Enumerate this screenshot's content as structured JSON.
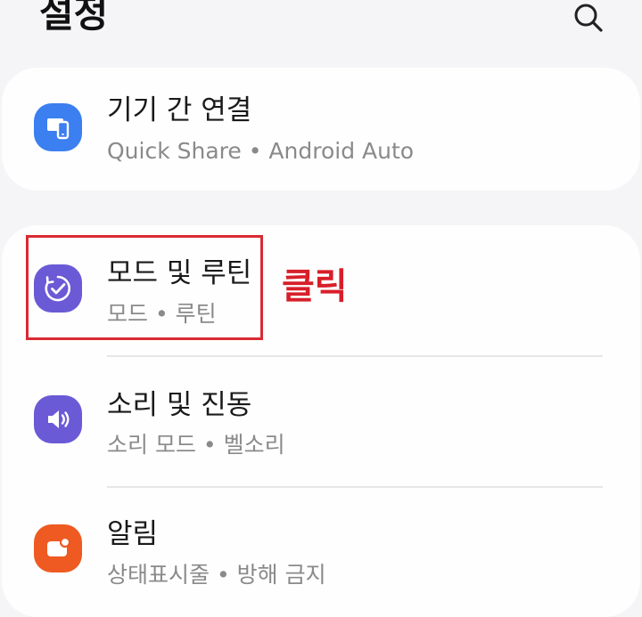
{
  "header": {
    "title": "설정",
    "search_icon": "search-icon"
  },
  "cards": [
    {
      "items": [
        {
          "title": "기기 간 연결",
          "subtitle": "Quick Share • Android Auto",
          "icon": "devices-icon",
          "icon_color": "#3b7ff0"
        }
      ]
    },
    {
      "items": [
        {
          "title": "모드 및 루틴",
          "subtitle": "모드 • 루틴",
          "icon": "routine-check-icon",
          "icon_color": "#6a5ad6"
        },
        {
          "title": "소리 및 진동",
          "subtitle": "소리 모드 • 벨소리",
          "icon": "speaker-icon",
          "icon_color": "#6a5ad6"
        },
        {
          "title": "알림",
          "subtitle": "상태표시줄 • 방해 금지",
          "icon": "notification-icon",
          "icon_color": "#ee5a22"
        }
      ]
    }
  ],
  "annotation": {
    "text": "클릭",
    "color": "#d71f2a"
  }
}
